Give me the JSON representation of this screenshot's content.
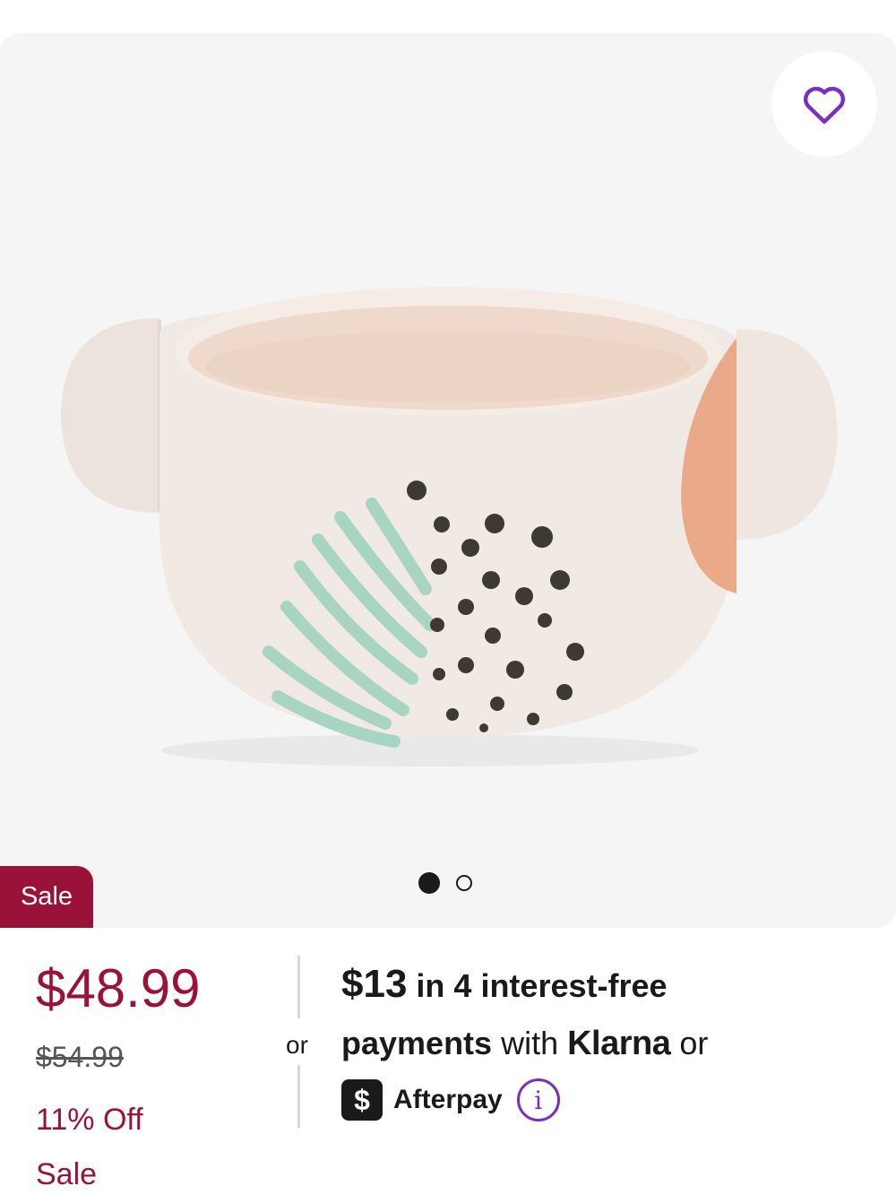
{
  "badge": {
    "label": "Sale"
  },
  "pricing": {
    "current_price": "$48.99",
    "original_price": "$54.99",
    "discount": "11% Off",
    "status": "Sale"
  },
  "installments": {
    "or_label": "or",
    "amount": "$13",
    "line1_rest": " in 4 interest-free",
    "line2_bold": "payments",
    "line2_with": " with ",
    "klarna_brand": "Klarna",
    "line2_or": " or",
    "afterpay_icon_glyph": "$",
    "afterpay_label": "Afterpay",
    "info_glyph": "i"
  },
  "gallery": {
    "total_images": 2,
    "active_index": 0
  },
  "colors": {
    "accent_sale": "#9b1239",
    "favorite_icon": "#7b2fbe",
    "card_background": "#f5f5f5"
  },
  "icons": {
    "favorite": "heart-outline-icon",
    "afterpay": "afterpay-logo-icon",
    "info": "info-circle-icon"
  }
}
